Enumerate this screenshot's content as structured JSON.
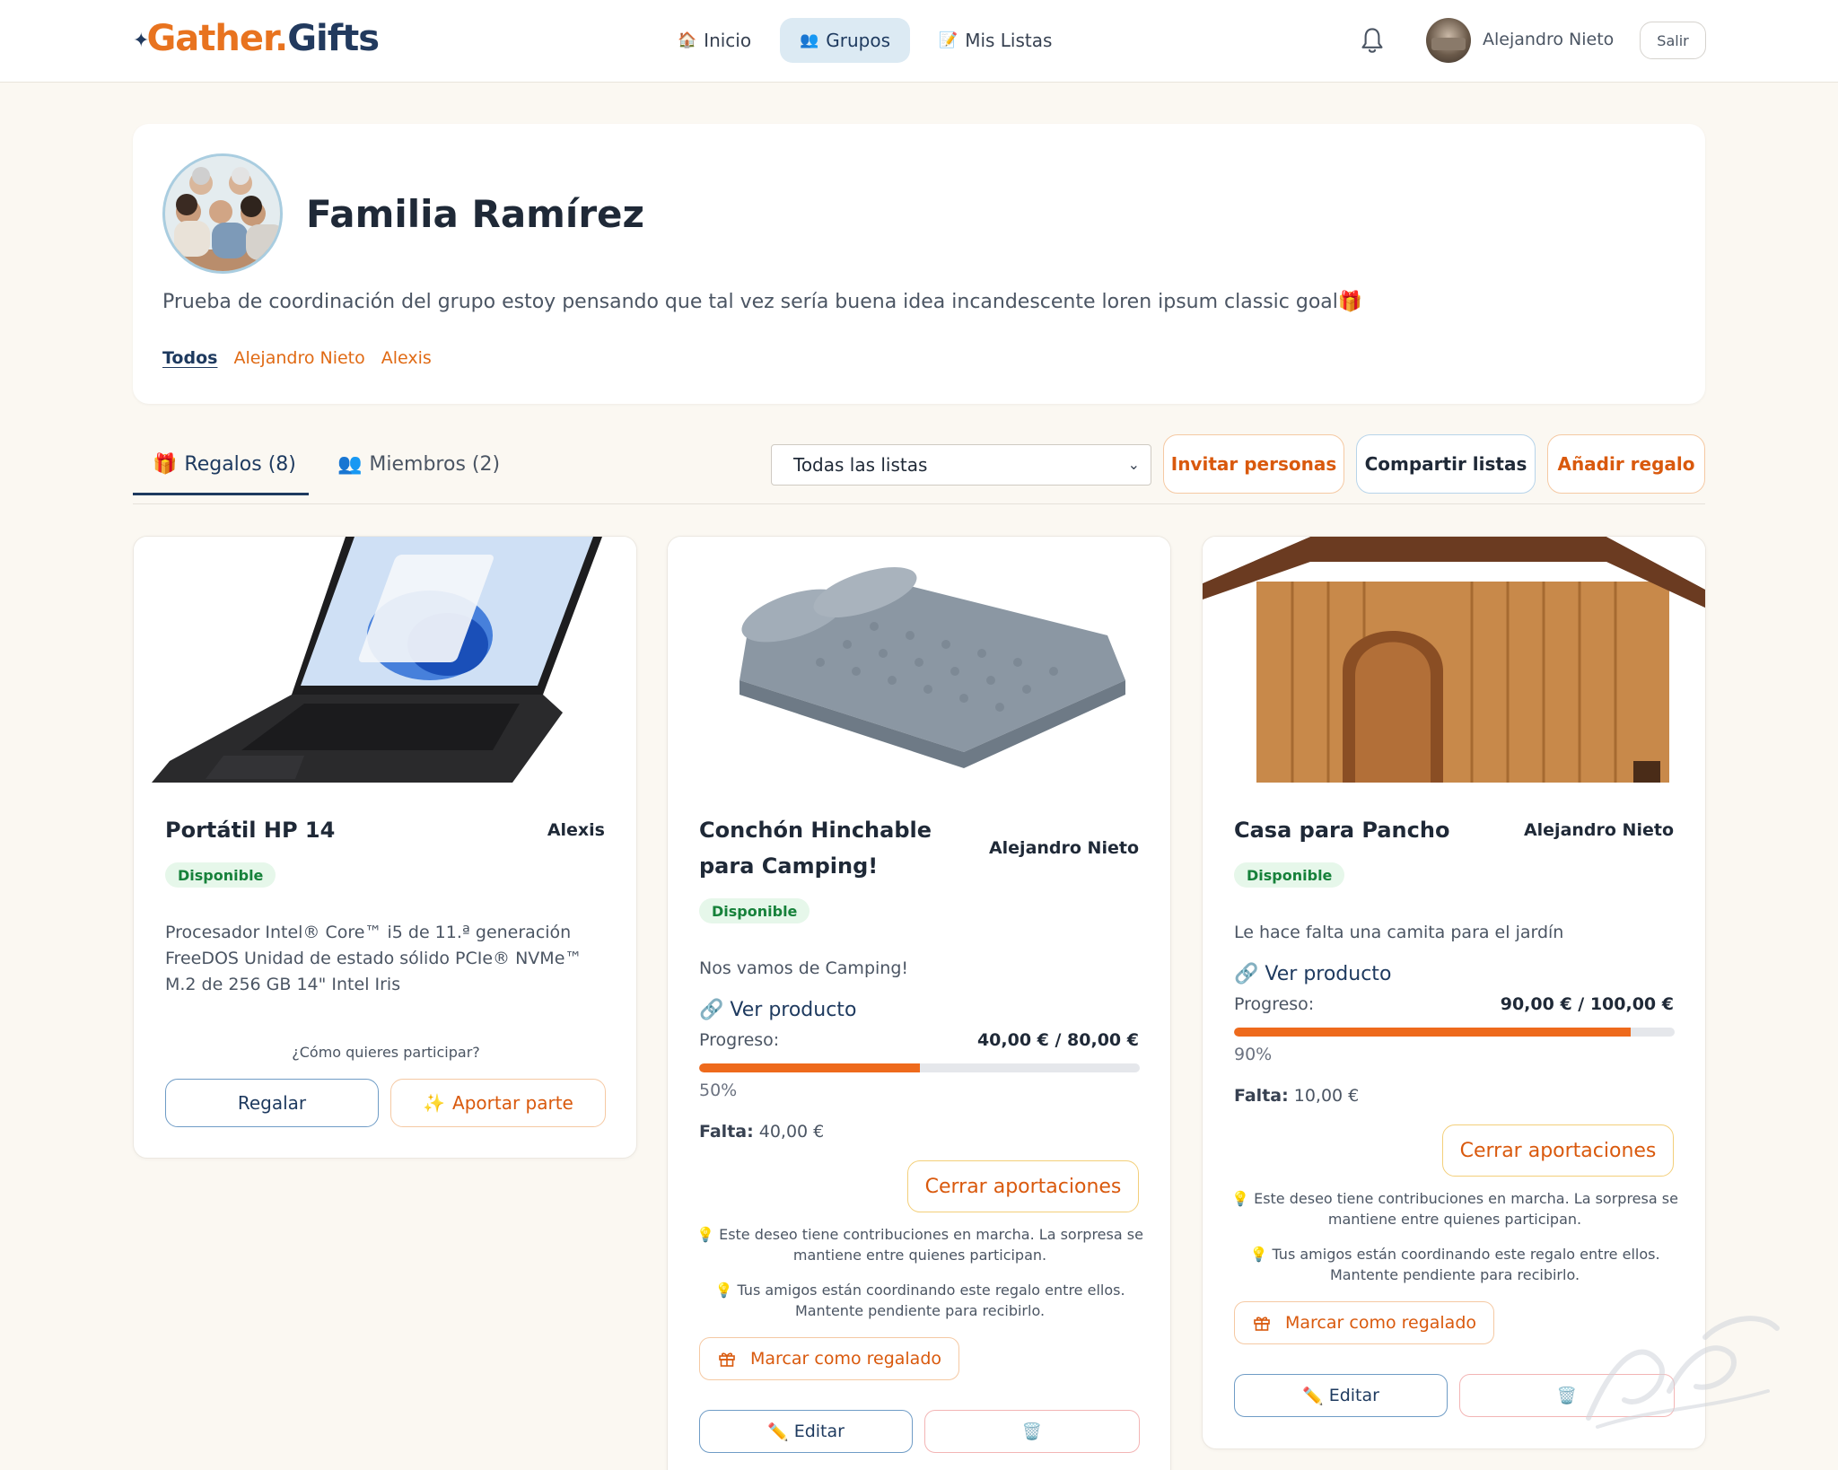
{
  "app": {
    "logo_left": "Gather",
    "logo_dot": ".",
    "logo_right": "Gifts"
  },
  "nav": {
    "items": [
      {
        "icon": "🏠",
        "label": "Inicio"
      },
      {
        "icon": "👥",
        "label": "Grupos"
      },
      {
        "icon": "📝",
        "label": "Mis Listas"
      }
    ],
    "active": "Grupos"
  },
  "user": {
    "name": "Alejandro Nieto",
    "logout_label": "Salir"
  },
  "group": {
    "title": "Familia Ramírez",
    "description": "Prueba de coordinación del grupo estoy pensando que tal vez sería buena idea incandescente loren ipsum classic goal🎁",
    "filters": [
      "Todos",
      "Alejandro Nieto",
      "Alexis"
    ],
    "active_filter": "Todos"
  },
  "tabs": [
    {
      "icon": "🎁",
      "label": "Regalos (8)"
    },
    {
      "icon": "👥",
      "label": "Miembros (2)"
    }
  ],
  "toolbar": {
    "list_select_value": "Todas las listas",
    "invite_label": "Invitar personas",
    "share_label": "Compartir listas",
    "add_label": "Añadir regalo"
  },
  "colors": {
    "accent_orange": "#ee6a1c",
    "brand_navy": "#1e3a5f",
    "available_green": "#16813a",
    "page_bg": "#fbf8f2"
  },
  "gifts": [
    {
      "title": "Portátil HP 14",
      "owner": "Alexis",
      "status": "Disponible",
      "description": "Procesador Intel® Core™ i5 de 11.ª generación FreeDOS Unidad de estado sólido PCIe® NVMe™ M.2 de 256 GB 14\" Intel Iris",
      "participate_prompt": "¿Cómo quieres participar?",
      "give_label": "Regalar",
      "contribute_icon": "✨",
      "contribute_label": "Aportar parte"
    },
    {
      "title": "Conchón Hinchable para Camping!",
      "owner": "Alejandro Nieto",
      "status": "Disponible",
      "description": "Nos vamos de Camping!",
      "link_icon": "🔗",
      "link_label": "Ver producto",
      "progress_label": "Progreso:",
      "progress_value": "40,00 € / 80,00 €",
      "progress_fraction": 0.5,
      "progress_pct": "50%",
      "missing_label": "Falta:",
      "missing_value": "40,00 €",
      "close_label": "Cerrar aportaciones",
      "note1": "💡 Este deseo tiene contribuciones en marcha. La sorpresa se mantiene entre quienes participan.",
      "note2": "💡 Tus amigos están coordinando este regalo entre ellos. Mantente pendiente para recibirlo.",
      "mark_label": "Marcar como regalado",
      "edit_icon": "✏️",
      "edit_label": "Editar",
      "delete_icon": "🗑️"
    },
    {
      "title": "Casa para Pancho",
      "owner": "Alejandro Nieto",
      "status": "Disponible",
      "description": "Le hace falta una camita para el jardín",
      "link_icon": "🔗",
      "link_label": "Ver producto",
      "progress_label": "Progreso:",
      "progress_value": "90,00 € / 100,00 €",
      "progress_fraction": 0.9,
      "progress_pct": "90%",
      "missing_label": "Falta:",
      "missing_value": "10,00 €",
      "close_label": "Cerrar aportaciones",
      "note1": "💡 Este deseo tiene contribuciones en marcha. La sorpresa se mantiene entre quienes participan.",
      "note2": "💡 Tus amigos están coordinando este regalo entre ellos. Mantente pendiente para recibirlo.",
      "mark_label": "Marcar como regalado",
      "edit_icon": "✏️",
      "edit_label": "Editar",
      "delete_icon": "🗑️"
    }
  ]
}
